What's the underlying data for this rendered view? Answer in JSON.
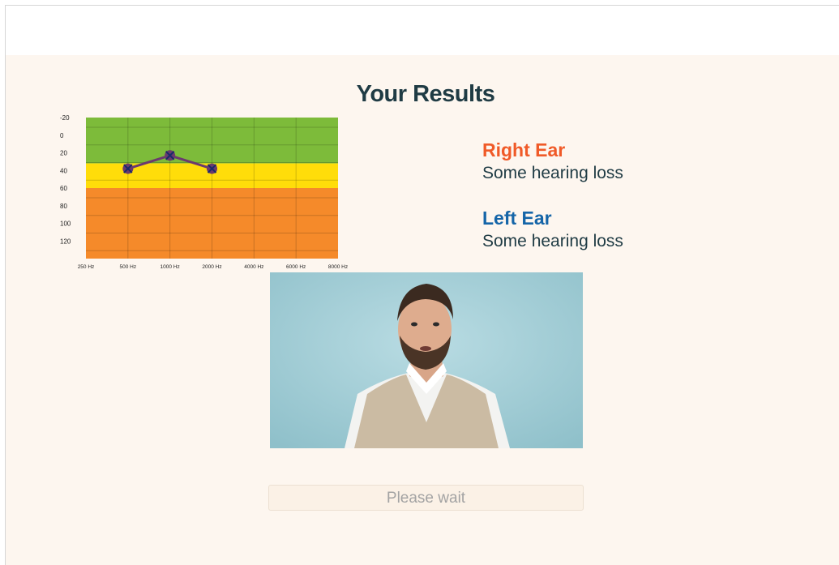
{
  "page": {
    "title": "Your Results"
  },
  "results": {
    "right_ear": {
      "label": "Right Ear",
      "status": "Some hearing loss"
    },
    "left_ear": {
      "label": "Left Ear",
      "status": "Some hearing loss"
    }
  },
  "button": {
    "label": "Please wait"
  },
  "colors": {
    "right_ear": "#f05a28",
    "left_ear": "#1565a8",
    "zone_normal": "#7dbb3a",
    "zone_mild": "#ffdd0a",
    "zone_moderate": "#f58a2a",
    "marker": "#6b3a6e",
    "marker_x": "#1a2a6b"
  },
  "chart_data": {
    "type": "line",
    "x": [
      "250 Hz",
      "500 Hz",
      "1000 Hz",
      "2000 Hz",
      "4000 Hz",
      "6000 Hz",
      "8000 Hz"
    ],
    "y_ticks": [
      -20,
      0,
      20,
      40,
      60,
      80,
      100,
      120
    ],
    "ylim": [
      -20,
      140
    ],
    "y_inverted": true,
    "bands": [
      {
        "from": -20,
        "to": 32,
        "color": "#7dbb3a"
      },
      {
        "from": 32,
        "to": 60,
        "color": "#ffdd0a"
      },
      {
        "from": 60,
        "to": 140,
        "color": "#f58a2a"
      }
    ],
    "series": [
      {
        "points": [
          {
            "x": "500 Hz",
            "y": 38
          },
          {
            "x": "1000 Hz",
            "y": 23
          },
          {
            "x": "2000 Hz",
            "y": 38
          }
        ]
      }
    ],
    "grid": true
  }
}
